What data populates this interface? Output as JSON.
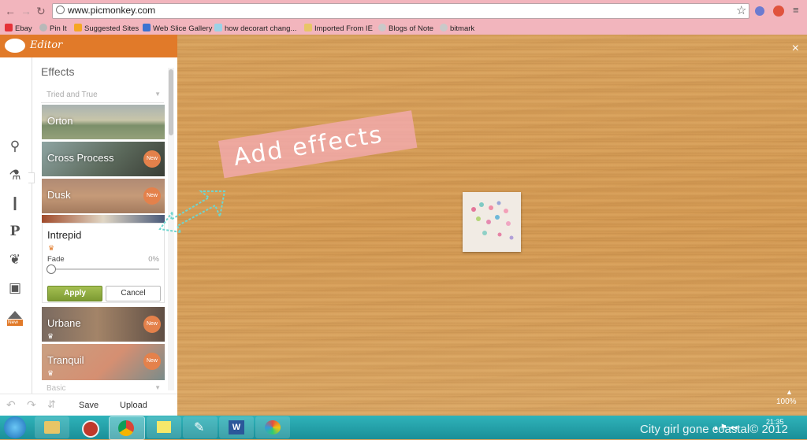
{
  "browser": {
    "url": "www.picmonkey.com",
    "bookmarks": [
      "Ebay",
      "Pin It",
      "Suggested Sites",
      "Web Slice Gallery",
      "how decorart chang...",
      "Imported From IE",
      "Blogs of Note",
      "bitmark"
    ]
  },
  "editor": {
    "title": "Editor"
  },
  "effects": {
    "title": "Effects",
    "section_dropdown": "Tried and True",
    "items": [
      {
        "label": "Orton",
        "new": false
      },
      {
        "label": "Cross Process",
        "new": true
      },
      {
        "label": "Dusk",
        "new": true
      },
      {
        "label": "Urbane",
        "new": true
      },
      {
        "label": "Tranquil",
        "new": true
      }
    ],
    "new_badge": "New",
    "bottom_dropdown": "Basic"
  },
  "panel": {
    "title": "Intrepid",
    "fade_label": "Fade",
    "fade_value": "0%",
    "fade_fraction": 0,
    "apply_label": "Apply",
    "cancel_label": "Cancel"
  },
  "tools": {
    "new_label": "New"
  },
  "bottom": {
    "save_label": "Save",
    "upload_label": "Upload"
  },
  "canvas": {
    "annotation": "Add effects",
    "zoom": "100%",
    "close_icon": "×"
  },
  "watermark": "City girl gone coastal© 2012",
  "clock": "21:35",
  "colors": {
    "accent": "#e17a29",
    "apply": "#8aa53a",
    "chrome": "#f2b5bd",
    "taskbar": "#1f9aa3"
  }
}
